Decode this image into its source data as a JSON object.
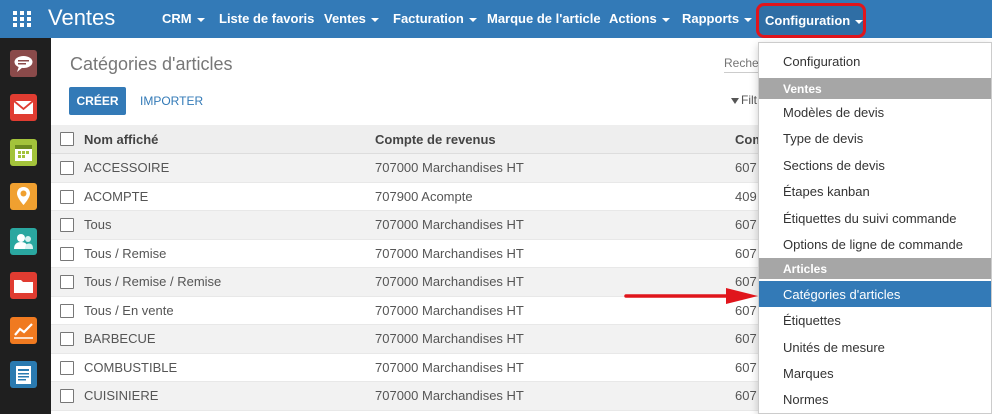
{
  "topbar": {
    "app_title": "Ventes",
    "menus": [
      "CRM",
      "Liste de favoris",
      "Ventes",
      "Facturation",
      "Marque de l'article",
      "Actions",
      "Rapports"
    ],
    "config_label": "Configuration"
  },
  "page": {
    "title": "Catégories d'articles",
    "create_label": "CRÉER",
    "import_label": "IMPORTER",
    "search_placeholder": "Reche",
    "filter_label": "Filt"
  },
  "table": {
    "columns": [
      "Nom affiché",
      "Compte de revenus",
      "Com"
    ],
    "rows": [
      {
        "name": "ACCESSOIRE",
        "revenue": "707000 Marchandises HT",
        "expense": "607"
      },
      {
        "name": "ACOMPTE",
        "revenue": "707900 Acompte",
        "expense": "409"
      },
      {
        "name": "Tous",
        "revenue": "707000 Marchandises HT",
        "expense": "607"
      },
      {
        "name": "Tous / Remise",
        "revenue": "707000 Marchandises HT",
        "expense": "607"
      },
      {
        "name": "Tous / Remise / Remise",
        "revenue": "707000 Marchandises HT",
        "expense": "607"
      },
      {
        "name": "Tous / En vente",
        "revenue": "707000 Marchandises HT",
        "expense": "607"
      },
      {
        "name": "BARBECUE",
        "revenue": "707000 Marchandises HT",
        "expense": "607"
      },
      {
        "name": "COMBUSTIBLE",
        "revenue": "707000 Marchandises HT",
        "expense": "607"
      },
      {
        "name": "CUISINIERE",
        "revenue": "707000 Marchandises HT",
        "expense": "607"
      }
    ]
  },
  "dropdown": {
    "items": [
      {
        "label": "Configuration",
        "kind": "item"
      },
      {
        "label": "Ventes",
        "kind": "header"
      },
      {
        "label": "Modèles de devis",
        "kind": "item"
      },
      {
        "label": "Type de devis",
        "kind": "item"
      },
      {
        "label": "Sections de devis",
        "kind": "item"
      },
      {
        "label": "Étapes kanban",
        "kind": "item"
      },
      {
        "label": "Étiquettes du suivi commande",
        "kind": "item"
      },
      {
        "label": "Options de ligne de commande",
        "kind": "item"
      },
      {
        "label": "Articles",
        "kind": "header"
      },
      {
        "label": "Catégories d'articles",
        "kind": "active"
      },
      {
        "label": "Étiquettes",
        "kind": "item"
      },
      {
        "label": "Unités de mesure",
        "kind": "item"
      },
      {
        "label": "Marques",
        "kind": "item"
      },
      {
        "label": "Normes",
        "kind": "item"
      }
    ]
  },
  "sidebar_icons": [
    "chat-icon",
    "mail-icon",
    "calendar-icon",
    "map-pin-icon",
    "contacts-icon",
    "folder-icon",
    "chart-icon",
    "document-icon"
  ],
  "colors": {
    "primary": "#337ab7",
    "highlight": "#e0151c",
    "sidebar": "#1f1f1f"
  }
}
